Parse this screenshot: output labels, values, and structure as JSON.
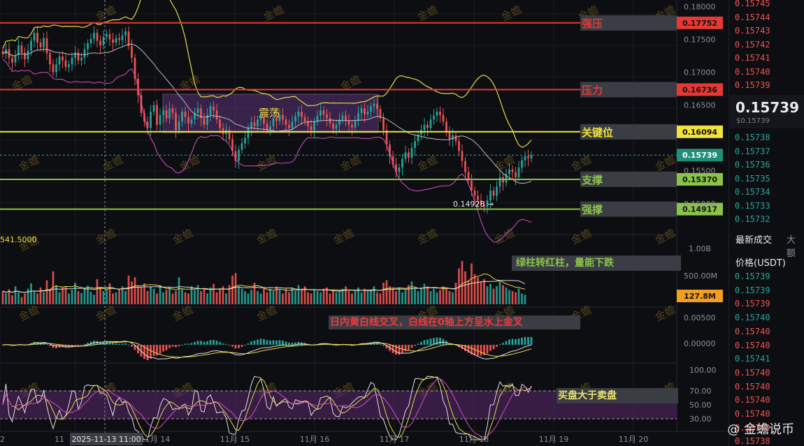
{
  "chart_data": {
    "type": "candlestick",
    "x_ticks": [
      "11月 14",
      "11月 15",
      "11月 16",
      "11月 17",
      "11月 18",
      "11月 19",
      "11月 20"
    ],
    "x_tick_left_partial": "11",
    "cursor_time": "2025-11-13 11:00",
    "price_axis": [
      "0.18000",
      "0.17500",
      "0.17000",
      "0.16500",
      "0.15500",
      "0.15000"
    ],
    "ylim": [
      0.147,
      0.181
    ],
    "levels": [
      {
        "name": "强压",
        "value": "0.17752",
        "price": 0.17752,
        "color": "#e53935",
        "tag_bg": "#e53935"
      },
      {
        "name": "压力",
        "value": "0.16736",
        "price": 0.16736,
        "color": "#e53935",
        "tag_bg": "#e53935"
      },
      {
        "name": "关键位",
        "value": "0.16094",
        "price": 0.16094,
        "color": "#f2e33b",
        "tag_bg": "#f2e33b"
      },
      {
        "name": "支撑",
        "value": "0.15370",
        "price": 0.1537,
        "color": "#8bc34a",
        "tag_bg": "#8bc34a"
      },
      {
        "name": "强撑",
        "value": "0.14917",
        "price": 0.14917,
        "color": "#8bc34a",
        "tag_bg": "#8bc34a"
      }
    ],
    "last_price": {
      "value": "0.15739",
      "price": 0.15739
    },
    "range_box_label": "震荡",
    "low_label": "0.14928",
    "closes": [
      0.1728,
      0.1735,
      0.1722,
      0.1715,
      0.1726,
      0.1741,
      0.173,
      0.172,
      0.1733,
      0.1748,
      0.176,
      0.1745,
      0.1738,
      0.1752,
      0.1729,
      0.1712,
      0.17,
      0.1712,
      0.1724,
      0.1718,
      0.1708,
      0.1712,
      0.1722,
      0.173,
      0.1718,
      0.1722,
      0.1735,
      0.1744,
      0.1751,
      0.176,
      0.1748,
      0.1741,
      0.1754,
      0.1758,
      0.175,
      0.1745,
      0.1752,
      0.1749,
      0.1756,
      0.1762,
      0.174,
      0.1722,
      0.169,
      0.1665,
      0.1638,
      0.1625,
      0.1615,
      0.164,
      0.165,
      0.162,
      0.1635,
      0.1642,
      0.163,
      0.1645,
      0.1638,
      0.1612,
      0.1625,
      0.164,
      0.1632,
      0.1622,
      0.1628,
      0.1638,
      0.1645,
      0.163,
      0.162,
      0.1635,
      0.1648,
      0.1642,
      0.1628,
      0.1615,
      0.1606,
      0.1612,
      0.1598,
      0.158,
      0.1565,
      0.1582,
      0.1592,
      0.16,
      0.1615,
      0.1624,
      0.1618,
      0.1628,
      0.1632,
      0.1622,
      0.1612,
      0.1618,
      0.163,
      0.1626,
      0.1635,
      0.1628,
      0.162,
      0.1615,
      0.1625,
      0.1633,
      0.164,
      0.1632,
      0.1625,
      0.1618,
      0.1612,
      0.1625,
      0.1634,
      0.1642,
      0.1636,
      0.163,
      0.1622,
      0.1614,
      0.162,
      0.1628,
      0.1634,
      0.1626,
      0.162,
      0.1616,
      0.1626,
      0.1638,
      0.1645,
      0.1636,
      0.164,
      0.1648,
      0.1652,
      0.1644,
      0.163,
      0.1612,
      0.159,
      0.1572,
      0.156,
      0.1548,
      0.1555,
      0.1568,
      0.1578,
      0.157,
      0.1585,
      0.1595,
      0.1605,
      0.1612,
      0.162,
      0.1615,
      0.1628,
      0.1634,
      0.164,
      0.1635,
      0.1625,
      0.161,
      0.1598,
      0.1604,
      0.1595,
      0.158,
      0.1565,
      0.1548,
      0.1535,
      0.152,
      0.1512,
      0.1505,
      0.1498,
      0.1495,
      0.1505,
      0.152,
      0.1512,
      0.1526,
      0.154,
      0.1532,
      0.1545,
      0.1552,
      0.1548,
      0.154,
      0.1555,
      0.1566,
      0.1572,
      0.1569,
      0.1574
    ],
    "volume_axis": [
      "1.00B",
      "500.00M"
    ],
    "volume_last": "127.8M",
    "volume_left_label": "541.5000",
    "volumes": [
      0.22,
      0.18,
      0.25,
      0.15,
      0.3,
      0.2,
      0.12,
      0.18,
      0.26,
      0.35,
      0.22,
      0.18,
      0.28,
      0.2,
      0.4,
      0.25,
      0.55,
      0.32,
      0.2,
      0.28,
      0.3,
      0.18,
      0.24,
      0.36,
      0.22,
      0.19,
      0.27,
      0.31,
      0.21,
      0.16,
      0.42,
      0.28,
      0.22,
      0.25,
      0.35,
      0.18,
      0.2,
      0.26,
      0.3,
      0.22,
      0.48,
      0.38,
      0.45,
      0.3,
      0.28,
      0.35,
      0.22,
      0.3,
      0.26,
      0.18,
      0.32,
      0.2,
      0.24,
      0.28,
      0.18,
      0.22,
      0.45,
      0.26,
      0.2,
      0.18,
      0.3,
      0.24,
      0.32,
      0.22,
      0.26,
      0.18,
      0.28,
      0.34,
      0.2,
      0.25,
      0.3,
      0.18,
      0.32,
      0.48,
      0.52,
      0.3,
      0.26,
      0.22,
      0.18,
      0.24,
      0.36,
      0.22,
      0.18,
      0.28,
      0.2,
      0.26,
      0.22,
      0.3,
      0.24,
      0.18,
      0.26,
      0.2,
      0.28,
      0.22,
      0.32,
      0.26,
      0.3,
      0.2,
      0.18,
      0.24,
      0.22,
      0.2,
      0.26,
      0.28,
      0.18,
      0.24,
      0.2,
      0.22,
      0.26,
      0.3,
      0.22,
      0.18,
      0.24,
      0.28,
      0.2,
      0.26,
      0.22,
      0.24,
      0.3,
      0.2,
      0.18,
      0.36,
      0.4,
      0.3,
      0.26,
      0.22,
      0.28,
      0.2,
      0.24,
      0.32,
      0.38,
      0.26,
      0.22,
      0.28,
      0.34,
      0.3,
      0.22,
      0.26,
      0.2,
      0.24,
      0.3,
      0.28,
      0.22,
      0.2,
      0.36,
      0.6,
      0.72,
      0.55,
      0.4,
      0.68,
      0.5,
      0.45,
      0.38,
      0.42,
      0.3,
      0.34,
      0.26,
      0.3,
      0.38,
      0.32,
      0.28,
      0.24,
      0.22,
      0.2,
      0.26,
      0.18,
      0.16
    ],
    "macd_axis": [
      "0.00500",
      "0.00000"
    ],
    "rsi_axis": [
      "100.00",
      "70.00",
      "50.00",
      "30.00"
    ]
  },
  "annotations": {
    "volume_note": "绿柱转红柱，量能下跌",
    "macd_note": "日内黄白线交叉，白线在0轴上方呈水上金叉",
    "rsi_note": "买盘大于卖盘"
  },
  "watermark": "金蟾",
  "orderbook": {
    "top_asks": [
      "0.15745",
      "0.15744",
      "0.15743",
      "0.15742",
      "0.15741",
      "0.15740",
      "0.15739"
    ],
    "mid_price": "0.15739",
    "mid_sub": "$0.15739",
    "bids": [
      "0.15738",
      "0.15737",
      "0.15736",
      "0.15735",
      "0.15734",
      "0.15733",
      "0.15732"
    ],
    "tab_latest": "最新成交",
    "tab_large": "大额",
    "col_price": "价格(USDT)",
    "trades": [
      {
        "p": "0.15739",
        "side": "buy"
      },
      {
        "p": "0.15739",
        "side": "buy"
      },
      {
        "p": "0.15739",
        "side": "sell"
      },
      {
        "p": "0.15740",
        "side": "buy"
      },
      {
        "p": "0.15740",
        "side": "sell"
      },
      {
        "p": "0.15740",
        "side": "sell"
      },
      {
        "p": "0.15741",
        "side": "buy"
      },
      {
        "p": "0.15740",
        "side": "sell"
      },
      {
        "p": "0.15740",
        "side": "sell"
      },
      {
        "p": "0.15740",
        "side": "sell"
      },
      {
        "p": "0.15740",
        "side": "sell"
      },
      {
        "p": "0.15740",
        "side": "sell"
      },
      {
        "p": "0.15738",
        "side": "sell"
      }
    ]
  },
  "brand": "@ 金蟾说币",
  "colors": {
    "up": "#26a69a",
    "down": "#ef5350",
    "bg": "#0d0e12"
  }
}
